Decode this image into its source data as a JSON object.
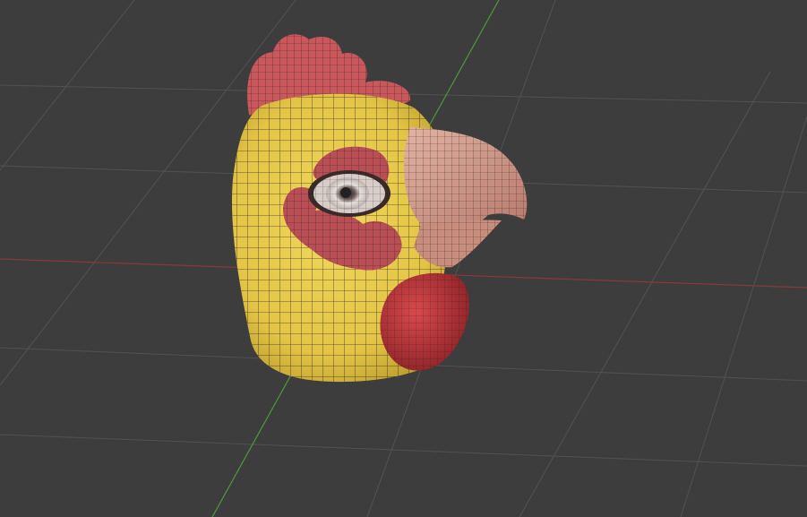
{
  "viewport": {
    "background": "#3d3d3d",
    "grid_color": "#525252",
    "x_axis_color": "#8a3a3a",
    "y_axis_color": "#4c9a3a"
  },
  "model": {
    "head_color": "#e6c84a",
    "comb_color": "#c9575b",
    "beak_color": "#d6a08f",
    "wattle_color": "#b8373c",
    "eyelid_color": "#b94f55",
    "wire_color": "#1c1c1c",
    "icons": [
      "chicken-head-mesh"
    ]
  }
}
